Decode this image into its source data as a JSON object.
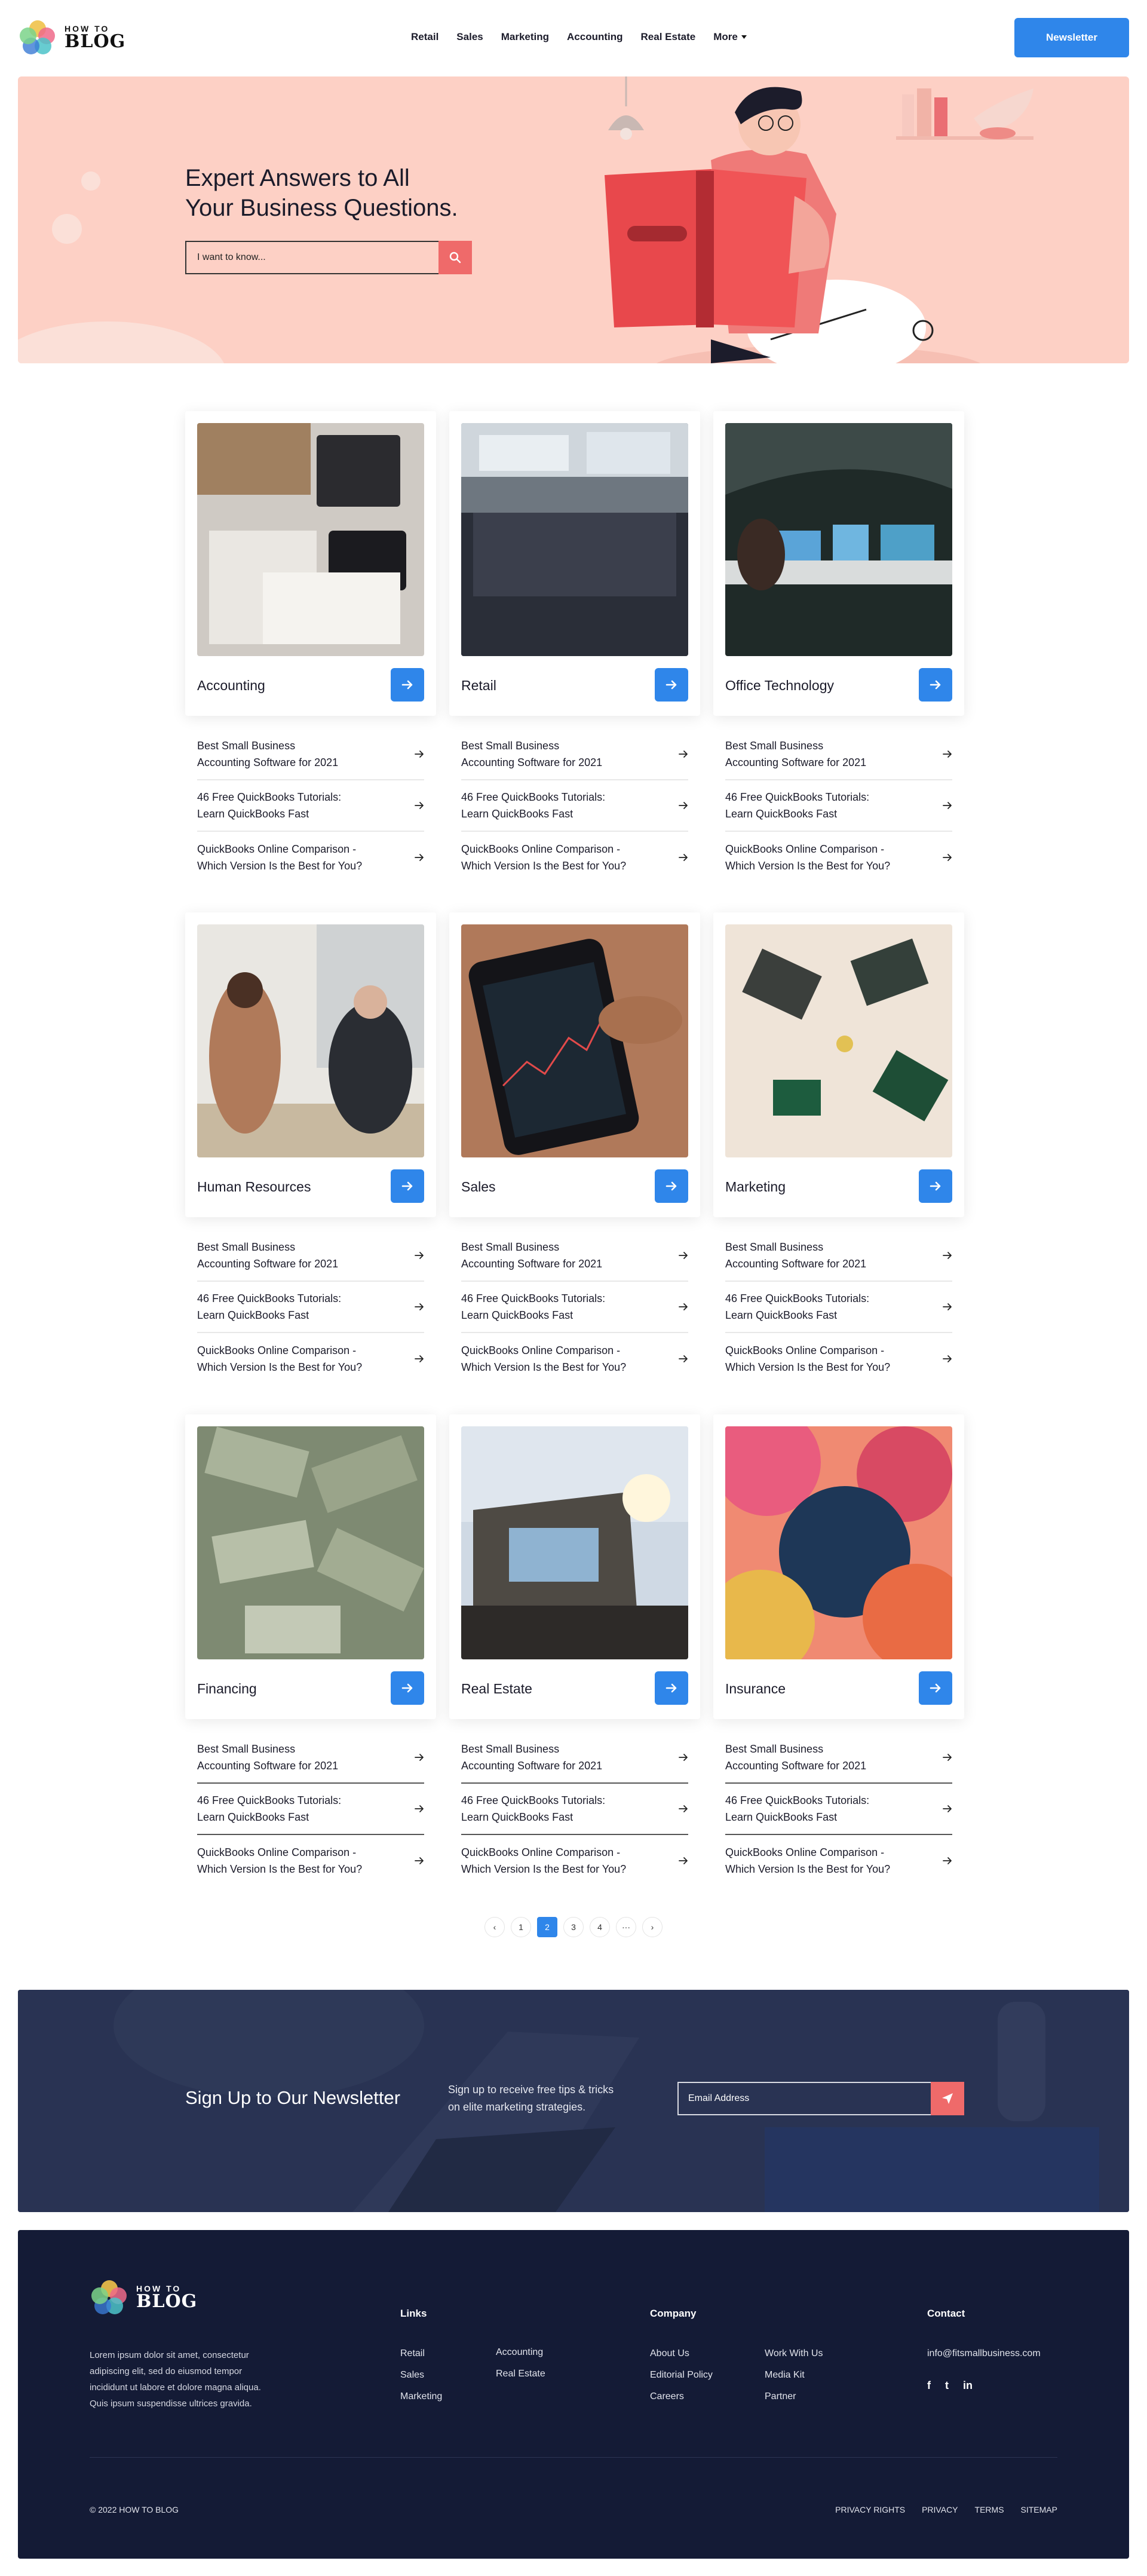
{
  "brand": {
    "small": "HOW TO",
    "big": "BLOG"
  },
  "nav": {
    "items": [
      "Retail",
      "Sales",
      "Marketing",
      "Accounting",
      "Real Estate",
      "More"
    ],
    "newsletter_label": "Newsletter"
  },
  "hero": {
    "title_line1": "Expert Answers to All",
    "title_line2": "Your Business Questions.",
    "search_placeholder": "I want to know..."
  },
  "link_texts": {
    "l1a": "Best Small Business",
    "l1b": "Accounting Software for 2021",
    "l2a": "46 Free QuickBooks Tutorials:",
    "l2b": "Learn QuickBooks Fast",
    "l3a": "QuickBooks Online Comparison -",
    "l3b": "Which Version Is the Best for You?"
  },
  "categories": [
    {
      "title": "Accounting"
    },
    {
      "title": "Retail"
    },
    {
      "title": "Office Technology"
    },
    {
      "title": "Human Resources"
    },
    {
      "title": "Sales"
    },
    {
      "title": "Marketing"
    },
    {
      "title": "Financing"
    },
    {
      "title": "Real Estate"
    },
    {
      "title": "Insurance"
    }
  ],
  "pagination": {
    "prev": "‹",
    "pages": [
      "1",
      "2",
      "3",
      "4",
      "···"
    ],
    "next": "›",
    "current": "2"
  },
  "newsletter": {
    "title": "Sign Up to Our Newsletter",
    "subtitle_line1": "Sign up to receive free tips & tricks",
    "subtitle_line2": "on elite marketing strategies.",
    "placeholder": "Email Address"
  },
  "footer": {
    "description_lines": [
      "Lorem ipsum dolor sit amet, consectetur",
      "adipiscing elit, sed do eiusmod tempor",
      "incididunt ut labore et dolore magna aliqua.",
      "Quis ipsum suspendisse ultrices gravida."
    ],
    "links_heading": "Links",
    "links_col1": [
      "Retail",
      "Sales",
      "Marketing"
    ],
    "links_col2": [
      "Accounting",
      "Real Estate"
    ],
    "company_heading": "Company",
    "company_col1": [
      "About Us",
      "Editorial Policy",
      "Careers"
    ],
    "company_col2": [
      "Work With Us",
      "Media Kit",
      "Partner"
    ],
    "contact_heading": "Contact",
    "email": "info@fitsmallbusiness.com",
    "social": [
      "f",
      "t",
      "in"
    ],
    "copyright": "© 2022 HOW TO BLOG",
    "bottom_links": [
      "PRIVACY RIGHTS",
      "PRIVACY",
      "TERMS",
      "SITEMAP"
    ]
  },
  "colors": {
    "accent": "#2f86ea",
    "hero_bg": "#fdd0c5",
    "coral": "#ef6a6a",
    "footer_bg": "#141b36"
  }
}
